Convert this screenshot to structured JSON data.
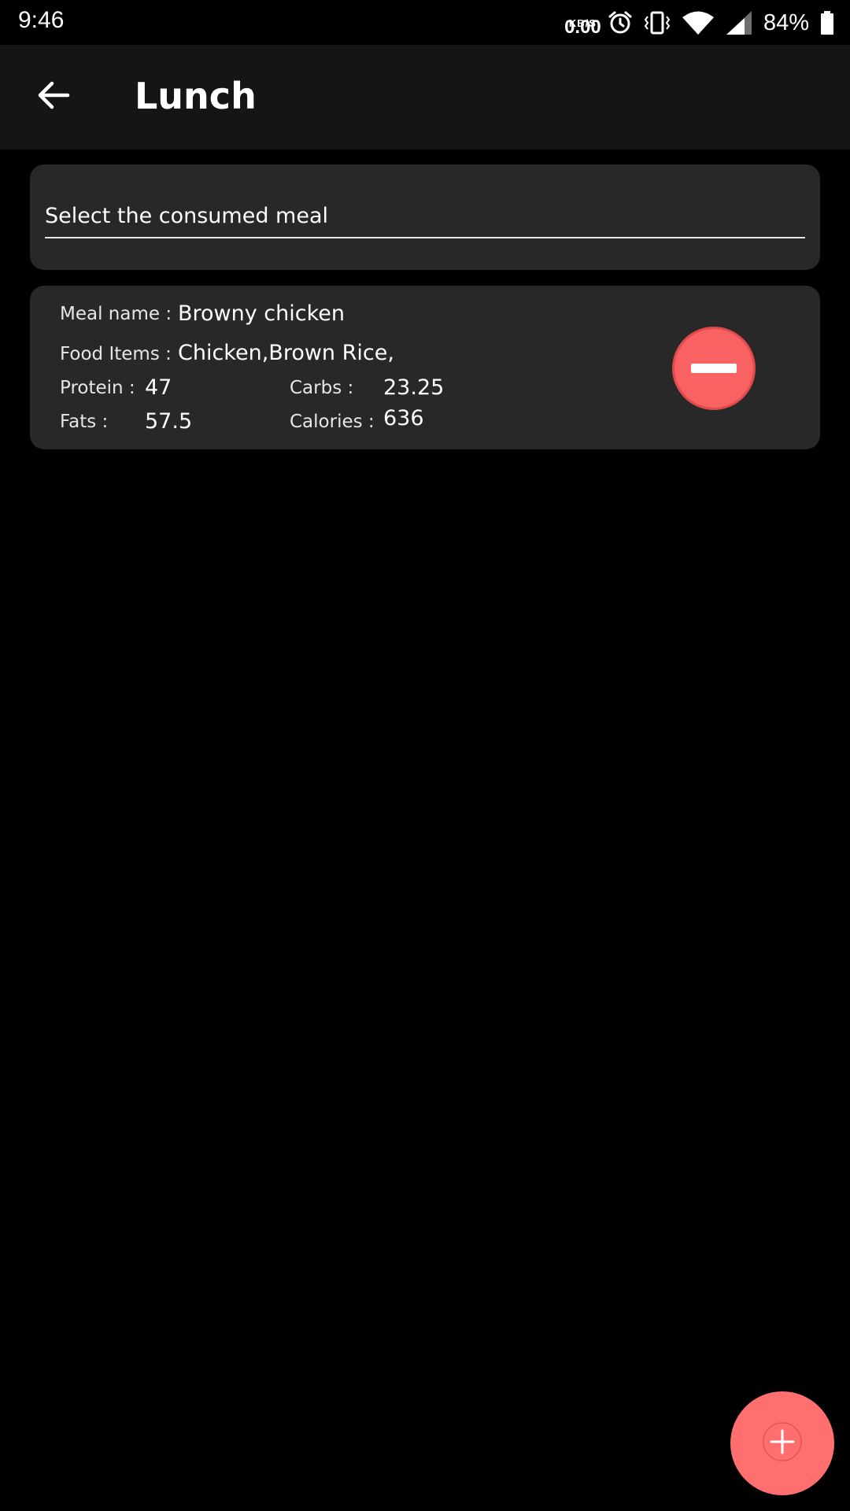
{
  "status_bar": {
    "time": "9:46",
    "net_speed_value": "0.00",
    "net_speed_unit": "KB/S",
    "battery_percent": "84%",
    "icons": [
      "alarm-icon",
      "vibrate-icon",
      "wifi-icon",
      "cell-signal-icon",
      "battery-icon"
    ]
  },
  "app_bar": {
    "title": "Lunch",
    "back_icon": "arrow-back-icon"
  },
  "select_meal": {
    "placeholder": "Select the consumed meal"
  },
  "meal_card": {
    "meal_name_label": "Meal name :",
    "meal_name": "Browny chicken",
    "food_items_label": "Food Items :",
    "food_items": "Chicken,Brown Rice,",
    "protein_label": "Protein :",
    "protein": "47",
    "carbs_label": "Carbs :",
    "carbs": "23.25",
    "fats_label": "Fats :",
    "fats": "57.5",
    "calories_label": "Calories :",
    "calories": "636",
    "remove_icon": "minus-icon"
  },
  "fab": {
    "icon": "plus-icon"
  },
  "colors": {
    "background": "#000000",
    "app_bar": "#151515",
    "card": "#282828",
    "accent": "#ff6f6f"
  }
}
